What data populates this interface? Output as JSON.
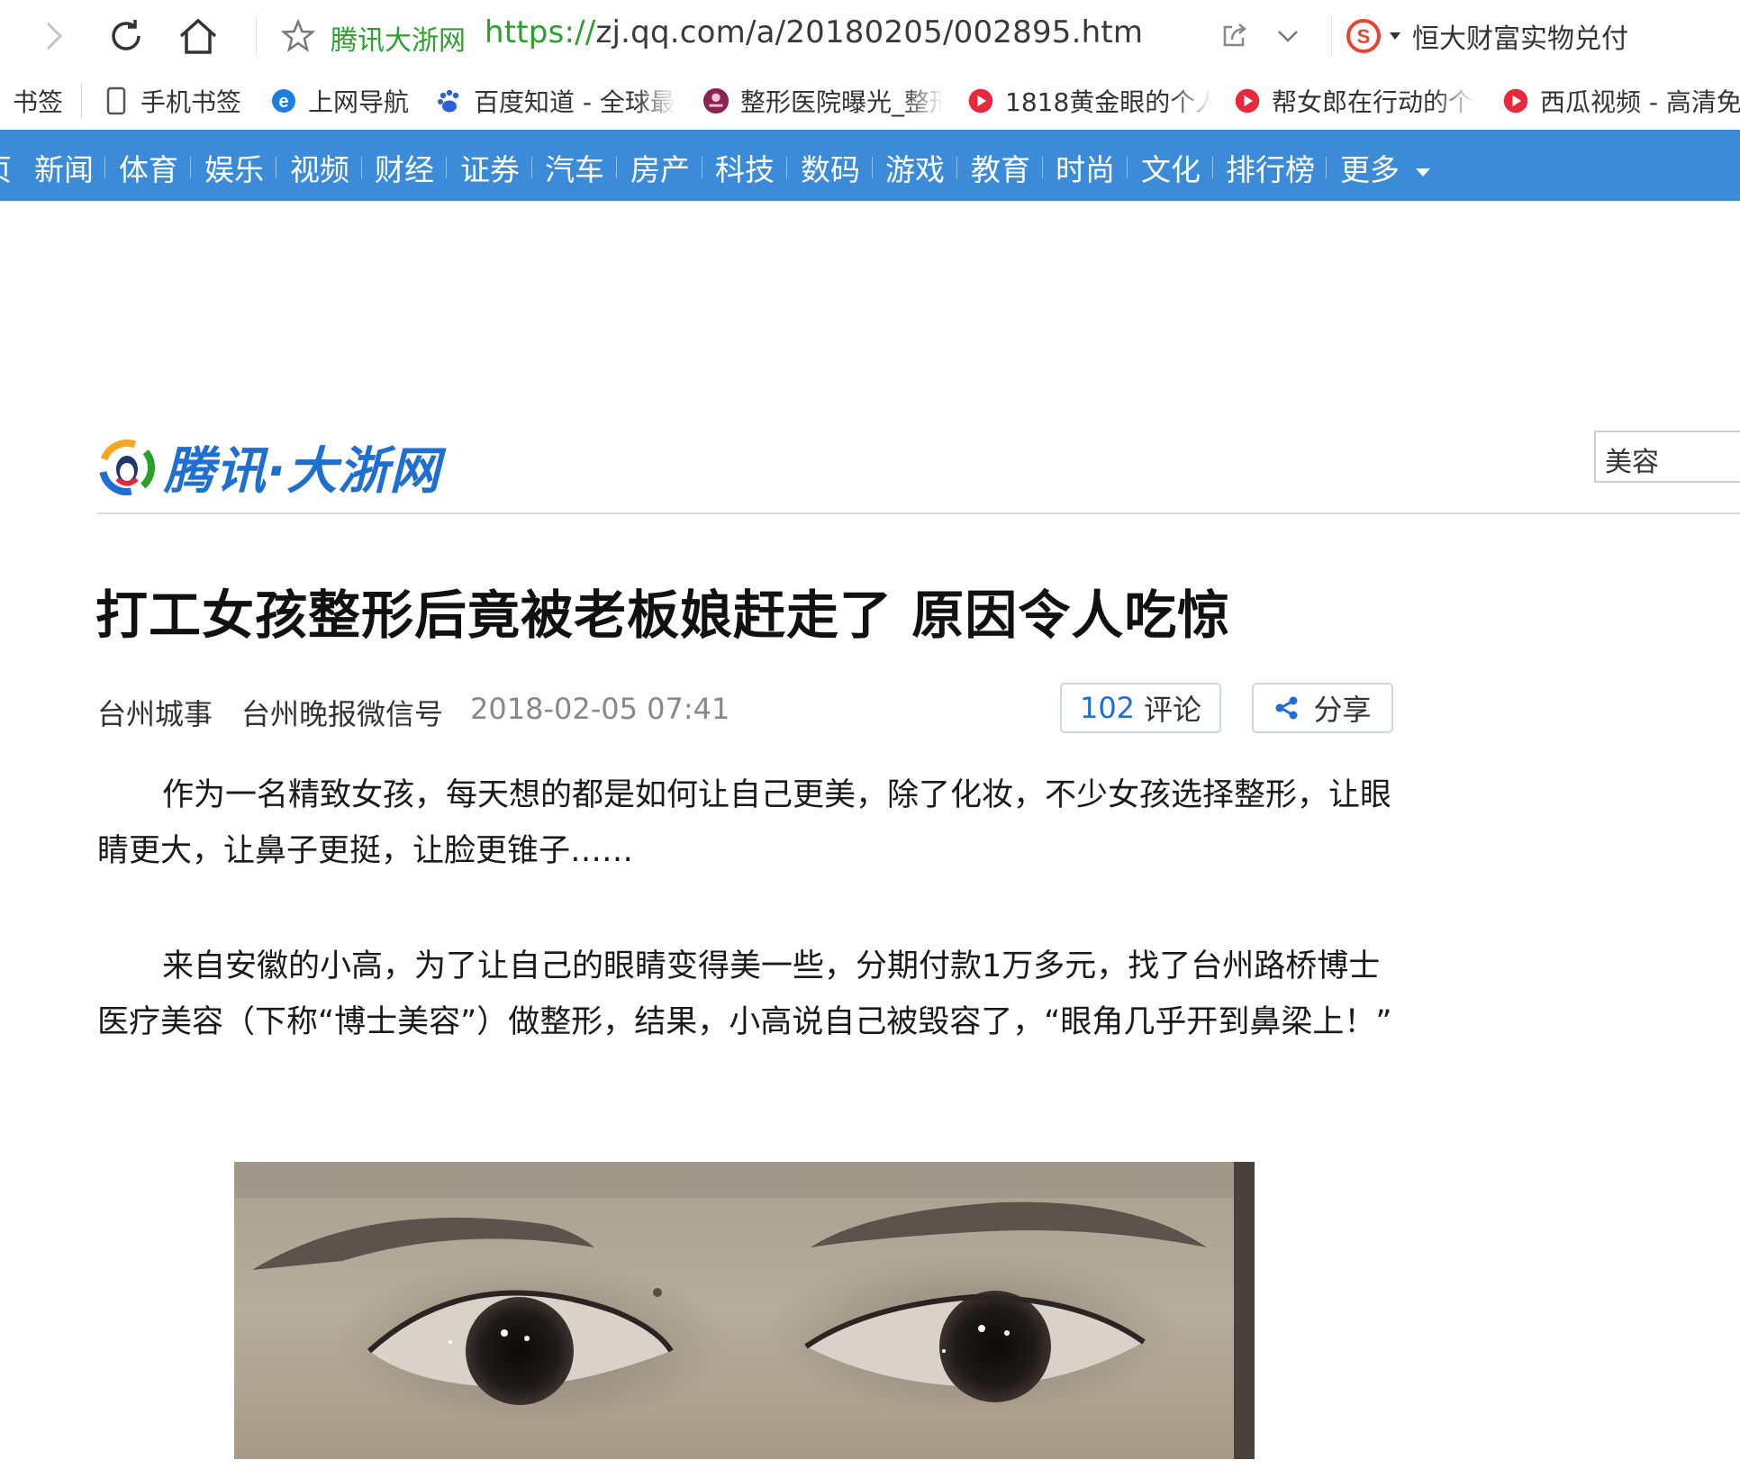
{
  "browser": {
    "site_name": "腾讯大浙网",
    "url_protocol": "https://",
    "url_rest": "zj.qq.com/a/20180205/002895.htm",
    "search_text": "恒大财富实物兑付"
  },
  "bookmarks": {
    "label": "书签",
    "items": [
      {
        "label": "手机书签",
        "icon": "phone-icon"
      },
      {
        "label": "上网导航",
        "icon": "ie-icon"
      },
      {
        "label": "百度知道 - 全球最",
        "icon": "baidu-paw-icon"
      },
      {
        "label": "整形医院曝光_整形",
        "icon": "hospital-logo-icon"
      },
      {
        "label": "1818黄金眼的个人",
        "icon": "video-play-icon"
      },
      {
        "label": "帮女郎在行动的个",
        "icon": "video-play-icon"
      },
      {
        "label": "西瓜视频 - 高清免",
        "icon": "video-play-icon"
      }
    ]
  },
  "navbar": {
    "partial_first": "页",
    "items": [
      "新闻",
      "体育",
      "娱乐",
      "视频",
      "财经",
      "证券",
      "汽车",
      "房产",
      "科技",
      "数码",
      "游戏",
      "教育",
      "时尚",
      "文化",
      "排行榜",
      "更多"
    ]
  },
  "site": {
    "logo_text": "腾讯·大浙网",
    "search_value": "美容"
  },
  "article": {
    "title": "打工女孩整形后竟被老板娘赶走了 原因令人吃惊",
    "source1": "台州城事",
    "source2": "台州晚报微信号",
    "time": "2018-02-05 07:41",
    "comment_count": "102",
    "comment_label": "评论",
    "share_label": "分享",
    "paragraphs": [
      "作为一名精致女孩，每天想的都是如何让自己更美，除了化妆，不少女孩选择整形，让眼睛更大，让鼻子更挺，让脸更锥子……",
      "来自安徽的小高，为了让自己的眼睛变得美一些，分期付款1万多元，找了台州路桥博士医疗美容（下称“博士美容”）做整形，结果，小高说自己被毁容了，“眼角几乎开到鼻梁上！”"
    ]
  },
  "colors": {
    "nav_blue": "#3b8bd9",
    "link_green": "#2ca02c",
    "accent_blue": "#1e6fd1"
  }
}
